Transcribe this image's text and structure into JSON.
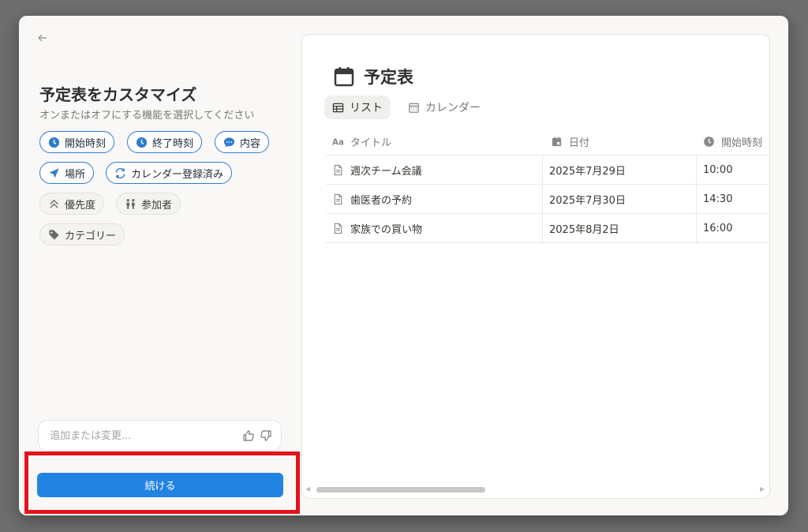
{
  "panel": {
    "title": "予定表をカスタマイズ",
    "subtitle": "オンまたはオフにする機能を選択してください",
    "chips": [
      {
        "label": "開始時刻",
        "state": "on",
        "icon": "clock-icon"
      },
      {
        "label": "終了時刻",
        "state": "on",
        "icon": "clock-icon"
      },
      {
        "label": "内容",
        "state": "on",
        "icon": "chat-bubble-icon"
      },
      {
        "label": "場所",
        "state": "on",
        "icon": "location-arrow-icon"
      },
      {
        "label": "カレンダー登録済み",
        "state": "on",
        "icon": "sync-icon"
      },
      {
        "label": "優先度",
        "state": "off",
        "icon": "chevrons-up-icon"
      },
      {
        "label": "参加者",
        "state": "off",
        "icon": "people-icon"
      },
      {
        "label": "カテゴリー",
        "state": "off",
        "icon": "tag-icon"
      }
    ],
    "input_placeholder": "追加または変更...",
    "continue_label": "続ける"
  },
  "preview": {
    "title": "予定表",
    "views": [
      {
        "label": "リスト",
        "active": true,
        "icon": "table-icon"
      },
      {
        "label": "カレンダー",
        "active": false,
        "icon": "calendar-icon"
      }
    ],
    "columns": [
      {
        "label": "タイトル",
        "icon": "text-aa-icon"
      },
      {
        "label": "日付",
        "icon": "date-icon"
      },
      {
        "label": "開始時刻",
        "icon": "clock-icon"
      }
    ],
    "rows": [
      {
        "title": "週次チーム会議",
        "date": "2025年7月29日",
        "start": "10:00"
      },
      {
        "title": "歯医者の予約",
        "date": "2025年7月30日",
        "start": "14:30"
      },
      {
        "title": "家族での買い物",
        "date": "2025年8月2日",
        "start": "16:00"
      }
    ]
  },
  "colors": {
    "accent": "#2383e2",
    "chip_on_border": "#2e7bd1",
    "highlight": "#e3131b"
  }
}
